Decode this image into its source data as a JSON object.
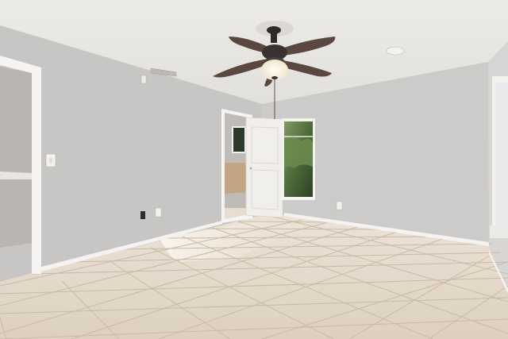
{
  "scene": {
    "kind": "empty-room-interior",
    "objects": [
      "ceiling-fan",
      "ceiling-light",
      "hvac-vent",
      "smoke-detector",
      "interior-door",
      "window",
      "tile-floor",
      "baseboards",
      "light-switch",
      "electrical-outlets"
    ],
    "colors": {
      "ceiling": "#e9e7e3",
      "wall_left": "#c9c7c6",
      "wall_back": "#cfcdcc",
      "wall_right": "#d7d5d4",
      "floor": "#e4d8c8",
      "floor_grout": "#c7b8a5",
      "trim": "#f4f3f1",
      "fan_blade": "#5a4740",
      "fan_body": "#2f2a29",
      "light_glow": "#fff6e4",
      "window_green": "#4d6b3a"
    }
  }
}
